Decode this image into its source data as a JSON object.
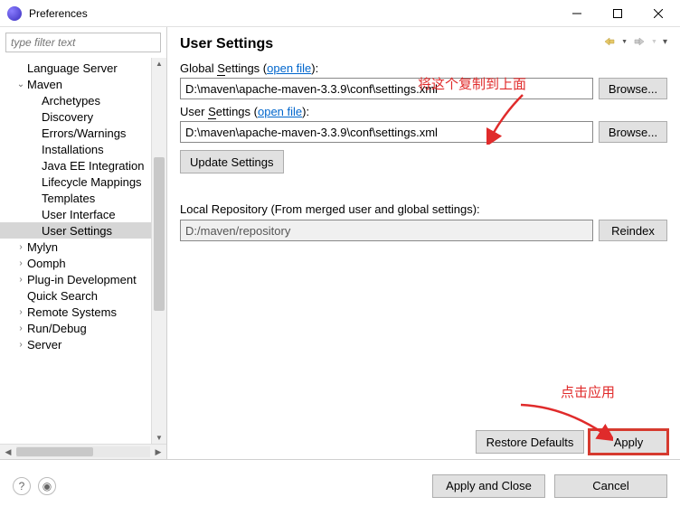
{
  "window": {
    "title": "Preferences"
  },
  "filter": {
    "placeholder": "type filter text"
  },
  "tree": [
    {
      "label": "Language Server",
      "level": 0,
      "twisty": ""
    },
    {
      "label": "Maven",
      "level": 0,
      "twisty": "v"
    },
    {
      "label": "Archetypes",
      "level": 1,
      "twisty": ""
    },
    {
      "label": "Discovery",
      "level": 1,
      "twisty": ""
    },
    {
      "label": "Errors/Warnings",
      "level": 1,
      "twisty": ""
    },
    {
      "label": "Installations",
      "level": 1,
      "twisty": ""
    },
    {
      "label": "Java EE Integration",
      "level": 1,
      "twisty": ""
    },
    {
      "label": "Lifecycle Mappings",
      "level": 1,
      "twisty": ""
    },
    {
      "label": "Templates",
      "level": 1,
      "twisty": ""
    },
    {
      "label": "User Interface",
      "level": 1,
      "twisty": ""
    },
    {
      "label": "User Settings",
      "level": 1,
      "twisty": "",
      "selected": true
    },
    {
      "label": "Mylyn",
      "level": 0,
      "twisty": ">"
    },
    {
      "label": "Oomph",
      "level": 0,
      "twisty": ">"
    },
    {
      "label": "Plug-in Development",
      "level": 0,
      "twisty": ">"
    },
    {
      "label": "Quick Search",
      "level": 0,
      "twisty": ""
    },
    {
      "label": "Remote Systems",
      "level": 0,
      "twisty": ">"
    },
    {
      "label": "Run/Debug",
      "level": 0,
      "twisty": ">"
    },
    {
      "label": "Server",
      "level": 0,
      "twisty": ">"
    }
  ],
  "page": {
    "title": "User Settings",
    "global_label_pre": "Global ",
    "global_label_mid": "Settings (",
    "global_label_underline": "S",
    "open_file": "open file",
    "global_label_post": "):",
    "global_value": "D:\\maven\\apache-maven-3.3.9\\conf\\settings.xml",
    "user_label_pre": "User ",
    "user_label_underline": "S",
    "user_label_mid": "ettings (",
    "user_label_post": "):",
    "user_value": "D:\\maven\\apache-maven-3.3.9\\conf\\settings.xml",
    "update_btn": "Update Settings",
    "local_repo_label": "Local Repository (From merged user and global settings):",
    "local_repo_value": "D:/maven/repository",
    "browse_btn": "Browse...",
    "reindex_btn": "Reindex",
    "restore_btn": "Restore Defaults",
    "apply_btn": "Apply"
  },
  "footer": {
    "apply_close": "Apply and Close",
    "cancel": "Cancel"
  },
  "annotations": {
    "top": "将这个复制到上面",
    "bottom": "点击应用"
  }
}
